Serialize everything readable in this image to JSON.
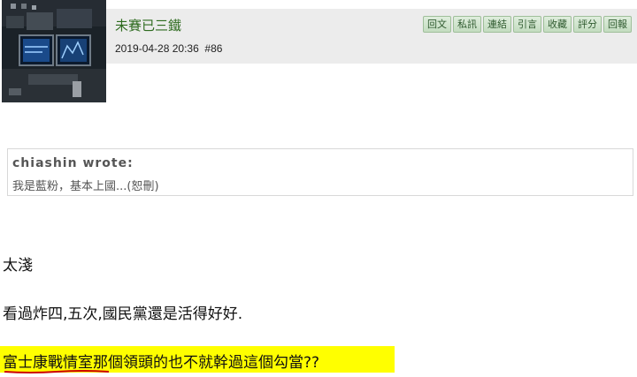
{
  "post": {
    "author": "未賽已三鐵",
    "timestamp": "2019-04-28 20:36",
    "post_number": "#86",
    "actions": [
      "回文",
      "私訊",
      "連結",
      "引言",
      "收藏",
      "評分",
      "回報"
    ]
  },
  "quote": {
    "author": "chiashin wrote:",
    "text": "我是藍粉，基本上國...(恕刪)"
  },
  "body": {
    "line1": "太淺",
    "line2": "看過炸四,五次,國民黨還是活得好好.",
    "line3": "富士康戰情室那個領頭的也不就幹過這個勾當??"
  },
  "colors": {
    "author": "#2e6b1f",
    "highlight": "#ffff00",
    "underline": "#cc0000",
    "button_bg": "#c3dcc0"
  },
  "icons": {
    "avatar": "cockpit-avatar-image"
  }
}
